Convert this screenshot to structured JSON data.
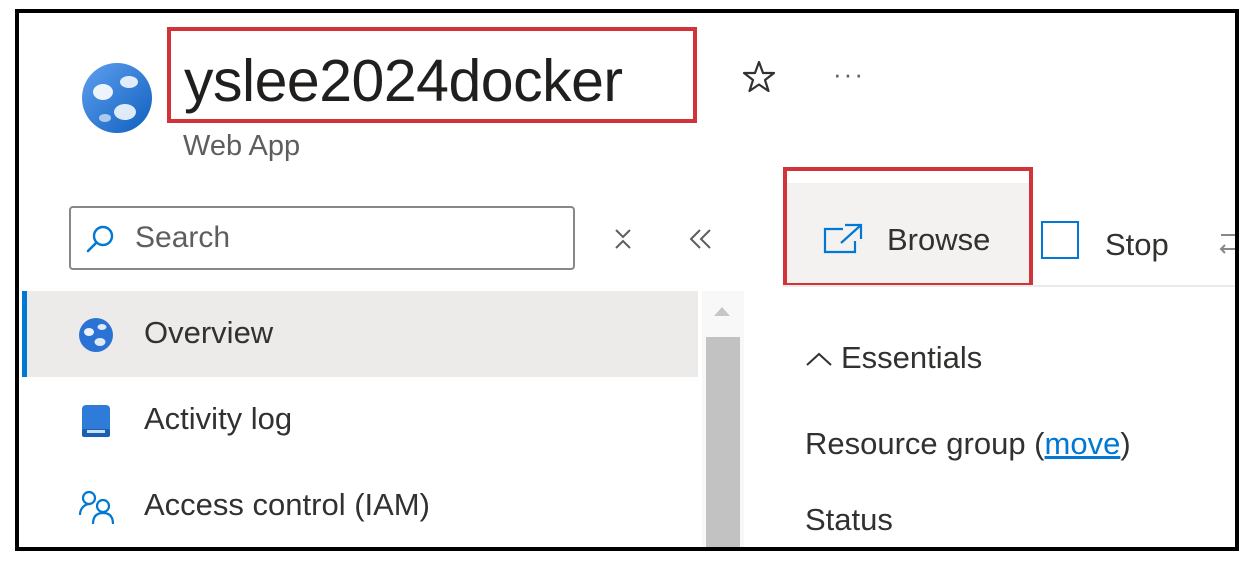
{
  "header": {
    "title": "yslee2024docker",
    "subtitle": "Web App",
    "star_label": "☆",
    "more_label": "···"
  },
  "search": {
    "placeholder": "Search",
    "value": ""
  },
  "sidebar": {
    "items": [
      {
        "label": "Overview",
        "icon": "globe-icon",
        "selected": true
      },
      {
        "label": "Activity log",
        "icon": "activity-log-icon",
        "selected": false
      },
      {
        "label": "Access control (IAM)",
        "icon": "people-icon",
        "selected": false
      }
    ]
  },
  "toolbar": {
    "browse_label": "Browse",
    "stop_label": "Stop"
  },
  "main": {
    "essentials_label": "Essentials",
    "resource_group_label": "Resource group (",
    "move_label": "move",
    "resource_group_close": ")",
    "status_label": "Status"
  },
  "colors": {
    "accent": "#0078d4",
    "highlight": "#d13438",
    "selected_bg": "#edebe9",
    "button_bg": "#f3f2f1"
  }
}
